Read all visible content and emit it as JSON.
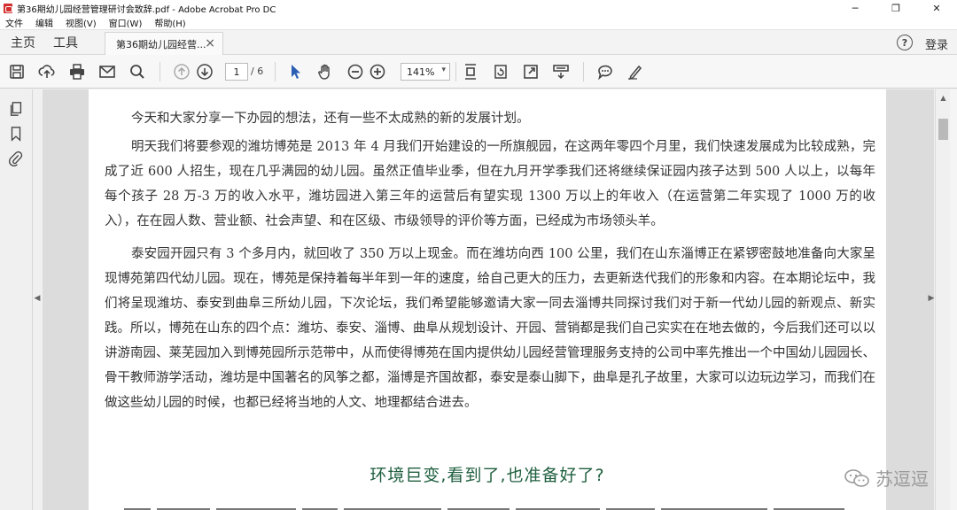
{
  "window": {
    "title": "第36期幼儿园经营管理研讨会致辞.pdf - Adobe Acrobat Pro DC",
    "minimize": "─",
    "restore": "❐",
    "close": "✕"
  },
  "menu": [
    "文件",
    "编辑",
    "视图(V)",
    "窗口(W)",
    "帮助(H)"
  ],
  "tabs": {
    "home": "主页",
    "tools": "工具",
    "document": "第36期幼儿园经营...",
    "close": "×",
    "help": "?",
    "login": "登录"
  },
  "toolbar": {
    "page_current": "1",
    "page_total": "/ 6",
    "zoom": "141%",
    "zoom_caret": "▾"
  },
  "nav": {
    "left_arrow": "◀",
    "right_arrow": "▶",
    "scroll_up": "▲"
  },
  "document": {
    "paragraphs": [
      "今天和大家分享一下办园的想法，还有一些不太成熟的新的发展计划。",
      "明天我们将要参观的潍坊博苑是 2013 年 4 月我们开始建设的一所旗舰园，在这两年零四个月里，我们快速发展成为比较成熟，完成了近 600 人招生，现在几乎满园的幼儿园。虽然正值毕业季，但在九月开学季我们还将继续保证园内孩子达到 500 人以上，以每年每个孩子 28 万-3 万的收入水平，潍坊园进入第三年的运营后有望实现 1300 万以上的年收入（在运营第二年实现了 1000 万的收入），在在园人数、营业额、社会声望、和在区级、市级领导的评价等方面，已经成为市场领头羊。",
      "泰安园开园只有 3 个多月内，就回收了 350 万以上现金。而在潍坊向西 100 公里，我们在山东淄博正在紧锣密鼓地准备向大家呈现博苑第四代幼儿园。现在，博苑是保持着每半年到一年的速度，给自己更大的压力，去更新迭代我们的形象和内容。在本期论坛中，我们将呈现潍坊、泰安到曲阜三所幼儿园，下次论坛，我们希望能够邀请大家一同去淄博共同探讨我们对于新一代幼儿园的新观点、新实践。所以，博苑在山东的四个点：潍坊、泰安、淄博、曲阜从规划设计、开园、营销都是我们自己实实在在地去做的，今后我们还可以以讲游南园、莱芜园加入到博苑园所示范带中，从而使得博苑在国内提供幼儿园经营管理服务支持的公司中率先推出一个中国幼儿园园长、骨干教师游学活动，潍坊是中国著名的风筝之都，淄博是齐国故都，泰安是泰山脚下，曲阜是孔子故里，大家可以边玩边学习，而我们在做这些幼儿园的时候，也都已经将当地的人文、地理都结合进去。"
    ],
    "heading": "环境巨变,看到了,也准备好了?",
    "watermark": "苏逗逗"
  }
}
